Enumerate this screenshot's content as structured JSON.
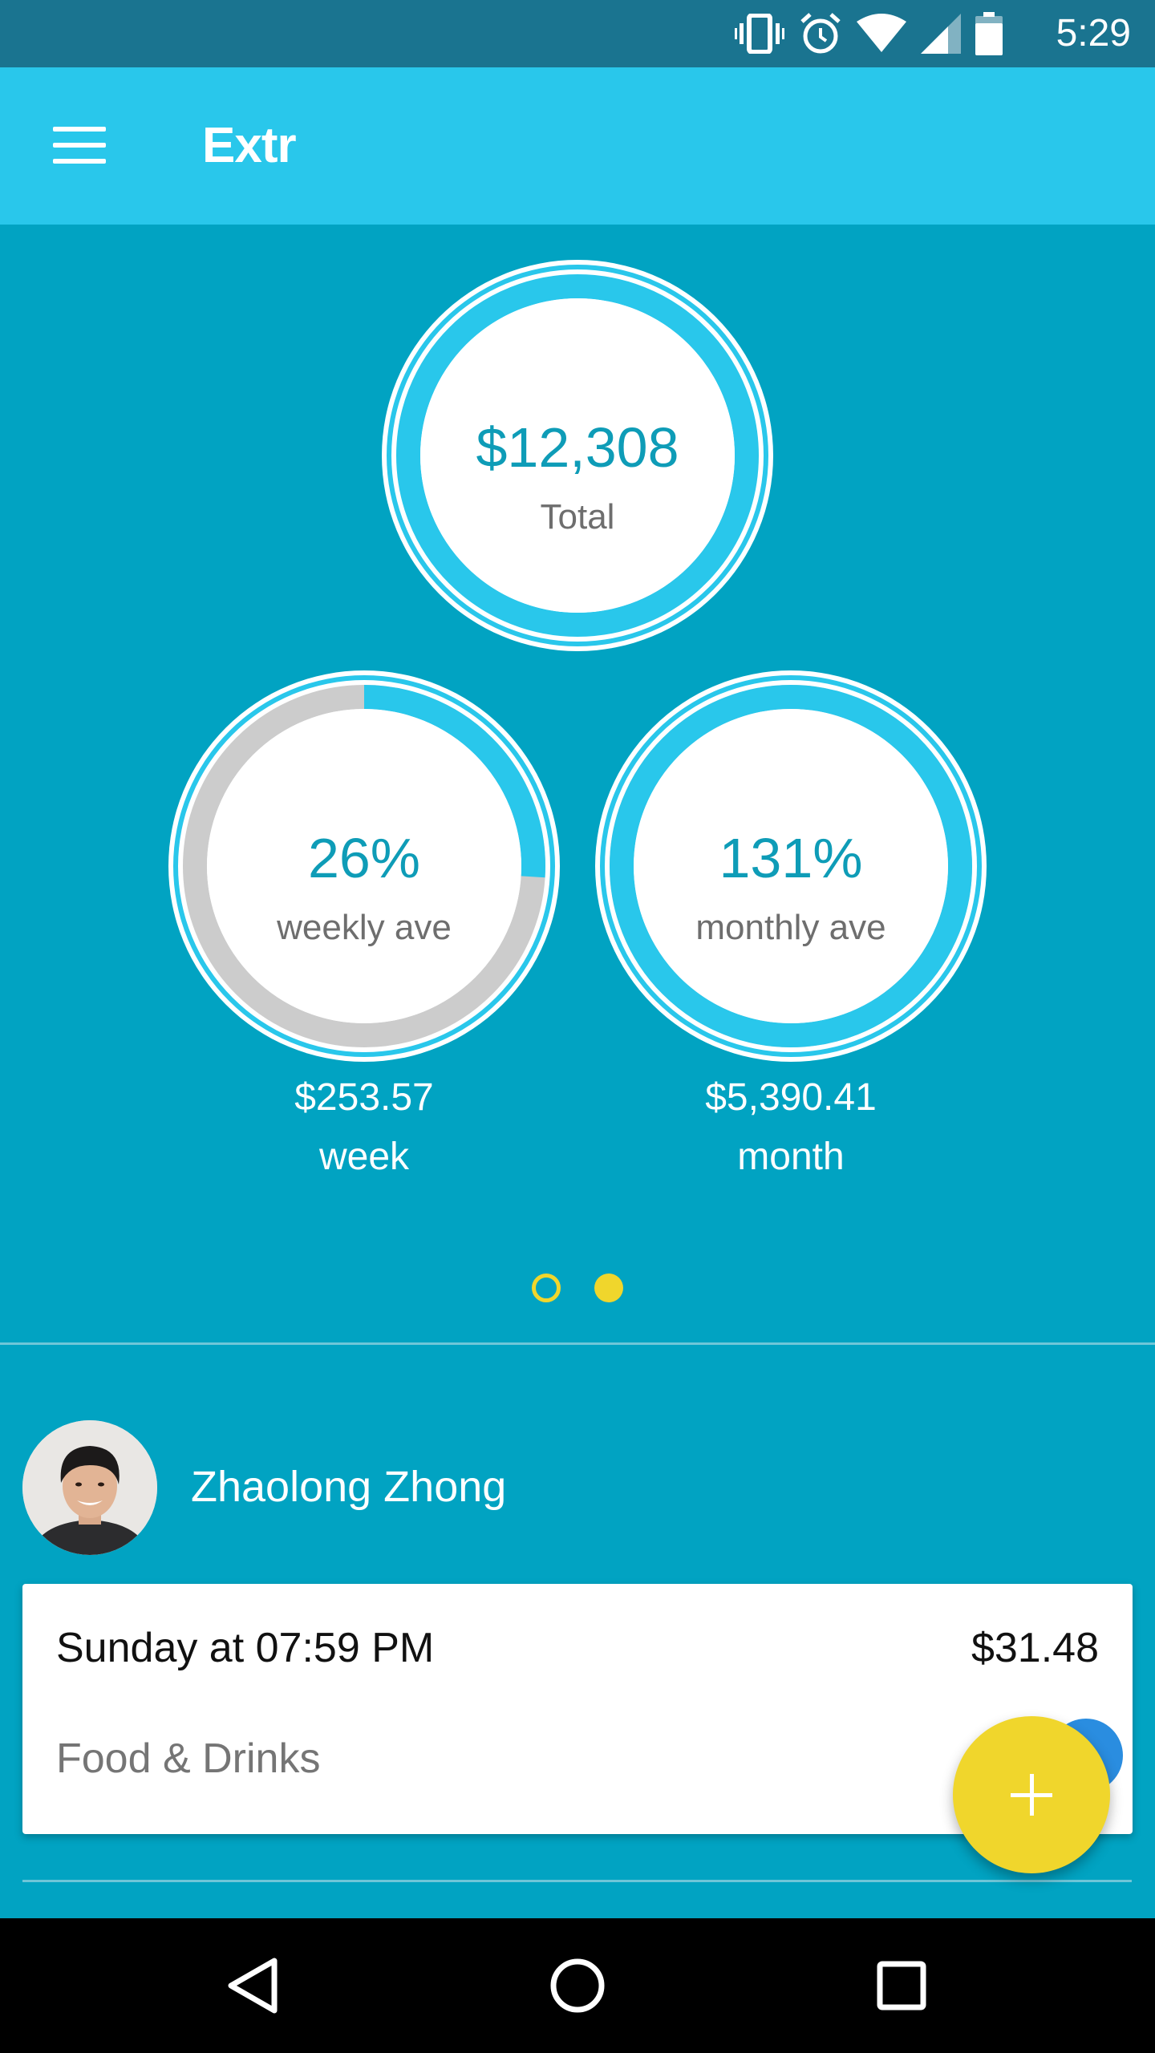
{
  "status_bar": {
    "time": "5:29",
    "icons": [
      "vibrate-icon",
      "alarm-icon",
      "wifi-icon",
      "signal-icon",
      "battery-icon"
    ]
  },
  "app_bar": {
    "title": "Extr",
    "menu_icon": "hamburger-menu-icon"
  },
  "summary": {
    "total": {
      "value": "$12,308",
      "label": "Total",
      "progress": 1.0
    },
    "weekly": {
      "value": "26%",
      "label": "weekly ave",
      "progress": 0.26,
      "amount": "$253.57",
      "period": "week"
    },
    "monthly": {
      "value": "131%",
      "label": "monthly ave",
      "progress": 1.0,
      "amount": "$5,390.41",
      "period": "month"
    }
  },
  "pager": {
    "pages": 2,
    "current": 2
  },
  "user": {
    "name": "Zhaolong Zhong"
  },
  "transaction": {
    "date": "Sunday at 07:59 PM",
    "amount": "$31.48",
    "category": "Food & Drinks"
  },
  "fab_icon": "plus-icon",
  "nav_bar": {
    "icons": [
      "back-icon",
      "home-icon",
      "recents-icon"
    ]
  },
  "colors": {
    "status_bar": "#1a7490",
    "app_bar": "#29c7eb",
    "background": "#01a3c2",
    "ring_accent": "#29c7eb",
    "ring_track": "#cccccc",
    "ring_text": "#0e9cb7",
    "fab": "#f0d62c"
  }
}
